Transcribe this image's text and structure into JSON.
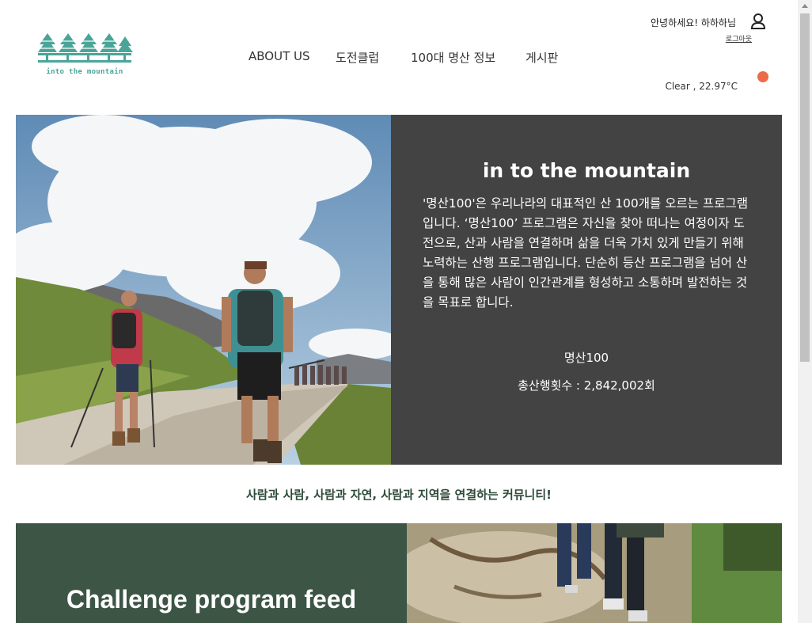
{
  "brand": {
    "logo_text": "into the mountain",
    "color": "#4aa598"
  },
  "nav": {
    "items": [
      {
        "label": "ABOUT US"
      },
      {
        "label": "도전클럽"
      },
      {
        "label": "100대 명산 정보"
      },
      {
        "label": "게시판"
      }
    ]
  },
  "user": {
    "greeting": "안녕하세요! 하하하님",
    "logout_label": "로그아웃",
    "icon": "user-icon"
  },
  "weather": {
    "text": "Clear , 22.97°C",
    "indicator_color": "#ee6b47"
  },
  "hero": {
    "title": "in to the mountain",
    "description": "'명산100'은 우리나라의 대표적인 산 100개를 오르는 프로그램 입니다. ‘명산100’ 프로그램은 자신을 찾아 떠나는 여정이자 도전으로, 산과 사람을 연결하며 삶을 더욱 가치 있게 만들기 위해 노력하는 산행 프로그램입니다. 단순히 등산 프로그램을 넘어 산을 통해 많은 사람이 인간관계를 형성하고 소통하며 발전하는 것을 목표로 합니다.",
    "program_name": "명산100",
    "total_climbs": "총산행횟수 : 2,842,002회",
    "panel_color": "#434343"
  },
  "tagline": "사람과 사람, 사람과 자연, 사람과 지역을 연결하는 커뮤니티!",
  "feed": {
    "title": "Challenge program feed",
    "panel_color": "#3c5545"
  }
}
